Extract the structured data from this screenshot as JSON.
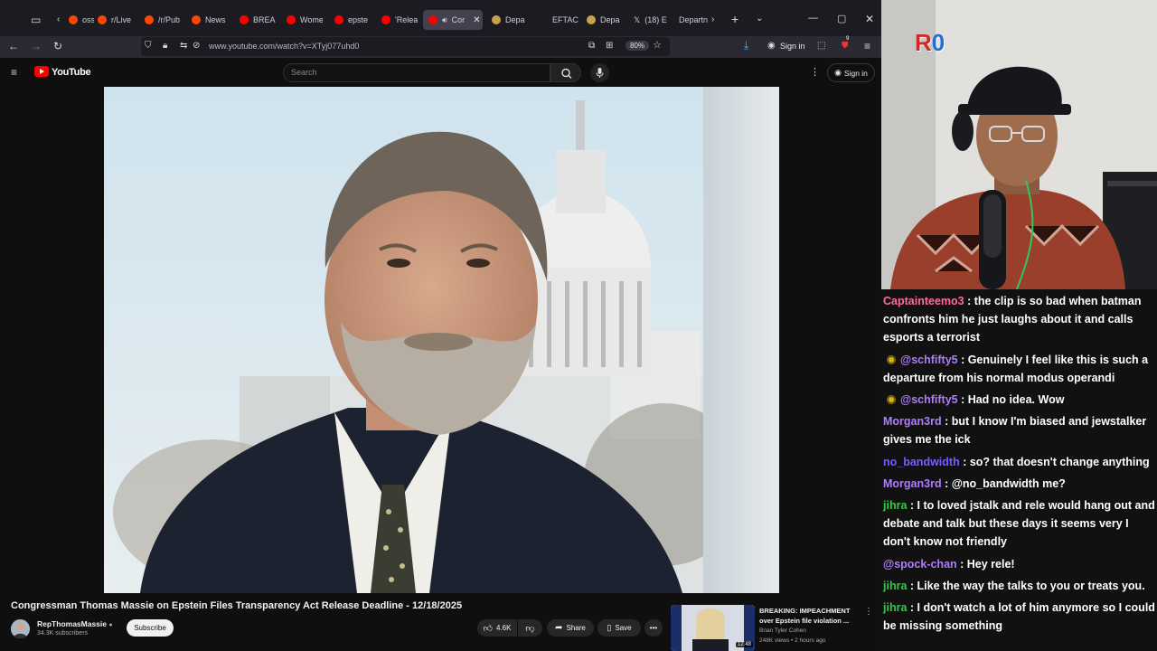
{
  "browser": {
    "tabs": [
      {
        "label": "osst",
        "color": "#ff4500"
      },
      {
        "label": "r/Live",
        "color": "#ff4500"
      },
      {
        "label": "/r/Pub",
        "color": "#ff4500"
      },
      {
        "label": "News",
        "color": "#ff4500"
      },
      {
        "label": "BREA",
        "color": "#ff0000"
      },
      {
        "label": "Wome",
        "color": "#ff0000"
      },
      {
        "label": "epste",
        "color": "#ff0000"
      },
      {
        "label": "'Relea",
        "color": "#ff0000"
      },
      {
        "label": "Cor",
        "color": "#ff0000"
      },
      {
        "label": "Depa",
        "color": "#c8a24a"
      },
      {
        "label": "EFTAC",
        "color": "#4a7dd4"
      },
      {
        "label": "Depa",
        "color": "#c8a24a"
      },
      {
        "label": "(18) E",
        "color": "#dddddd"
      },
      {
        "label": "Departn",
        "color": "#4a7dd4"
      }
    ],
    "url": "www.youtube.com/watch?v=XTyj077uhd0",
    "zoom": "80%",
    "signin_label": "Sign in",
    "notif_count": "9"
  },
  "youtube": {
    "wordmark": "YouTube",
    "search_placeholder": "Search",
    "signin_label": "Sign in",
    "video": {
      "title": "Congressman Thomas Massie on Epstein Files Transparency Act Release Deadline - 12/18/2025",
      "channel": "RepThomasMassie",
      "subscribers": "34.3K subscribers",
      "subscribe_label": "Subscribe",
      "likes": "4.6K",
      "share_label": "Share",
      "save_label": "Save"
    },
    "recommended": {
      "title": "BREAKING: IMPEACHMENT over Epstein file violation ...",
      "channel": "Brian Tyler Cohen",
      "meta": "248K views • 2 hours ago",
      "duration": "12:48"
    }
  },
  "stream": {
    "badge_r": "R",
    "badge_0": "0"
  },
  "chat": {
    "messages": [
      {
        "user": "Captainteemo3",
        "color": "#ff6b9c",
        "text": "the clip is so bad when batman confronts him he just laughs about it and calls esports a terrorist",
        "badge": false
      },
      {
        "user": "@schfifty5",
        "color": "#b07cff",
        "text": "Genuinely I feel like this is such a departure from his normal modus operandi",
        "badge": true
      },
      {
        "user": "@schfifty5",
        "color": "#b07cff",
        "text": "Had no idea. Wow",
        "badge": true
      },
      {
        "user": "Morgan3rd",
        "color": "#b07cff",
        "text": "but I know I'm biased and jewstalker gives me the ick",
        "badge": false
      },
      {
        "user": "no_bandwidth",
        "color": "#7a5cff",
        "text": "so? that doesn't change anything",
        "badge": false
      },
      {
        "user": "Morgan3rd",
        "color": "#b07cff",
        "text": "@no_bandwidth me?",
        "badge": false
      },
      {
        "user": "jihra",
        "color": "#2ecc40",
        "text": "I to loved jstalk and rele would hang out and debate and talk but these days it seems very I don't know not friendly",
        "badge": false
      },
      {
        "user": "@spock-chan",
        "color": "#b07cff",
        "text": "Hey rele!",
        "badge": false
      },
      {
        "user": "jihra",
        "color": "#2ecc40",
        "text": "Like the way the talks to you or treats you.",
        "badge": false
      },
      {
        "user": "jihra",
        "color": "#2ecc40",
        "text": "I don't watch a lot of him anymore so I could be missing something",
        "badge": false
      }
    ]
  }
}
